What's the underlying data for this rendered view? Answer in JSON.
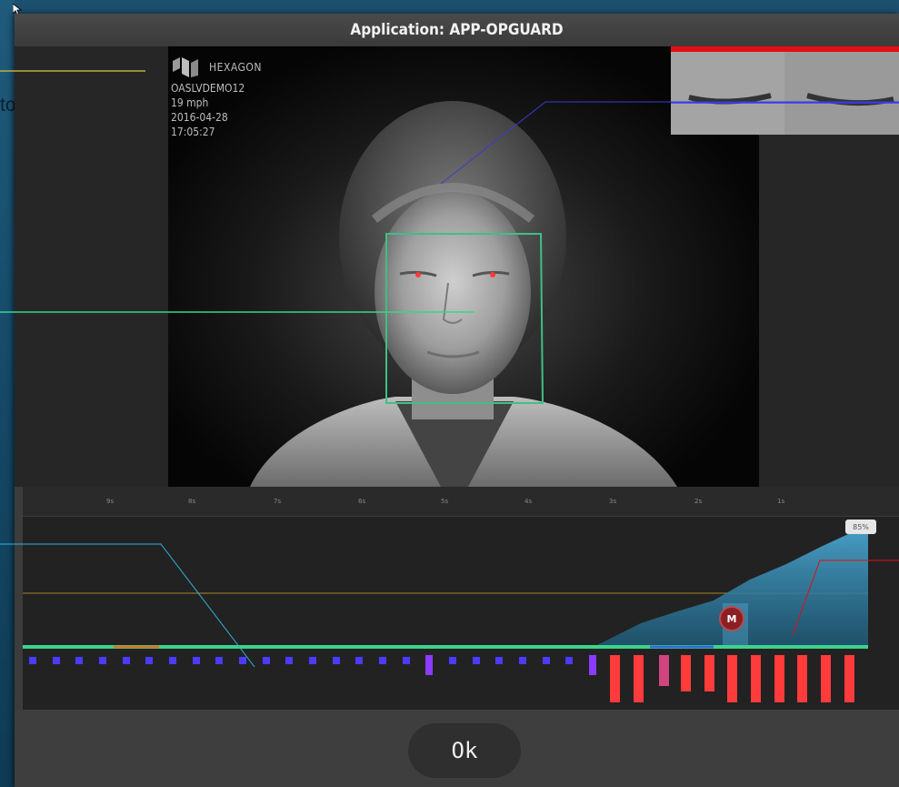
{
  "background_slide": {
    "partial_text": "to"
  },
  "dialog": {
    "title": "Application: APP-OPGUARD",
    "ok_label": "Ok"
  },
  "camera": {
    "brand": "HEXAGON",
    "device_id": "OASLVDEMO12",
    "speed": "19 mph",
    "date": "2016-04-28",
    "time": "17:05:27"
  },
  "timeline": {
    "tick_labels": [
      "9s",
      "8s",
      "7s",
      "6s",
      "5s",
      "4s",
      "3s",
      "2s",
      "1s"
    ],
    "badge_text": "85%",
    "marker_label": "M"
  },
  "colors": {
    "alert_red": "#ff3b3b",
    "eye_closure_fill": "#4aa7d1",
    "track_green": "#3bd48c",
    "face_box": "#3fbf86",
    "blink_blue": "#4b3bff"
  }
}
